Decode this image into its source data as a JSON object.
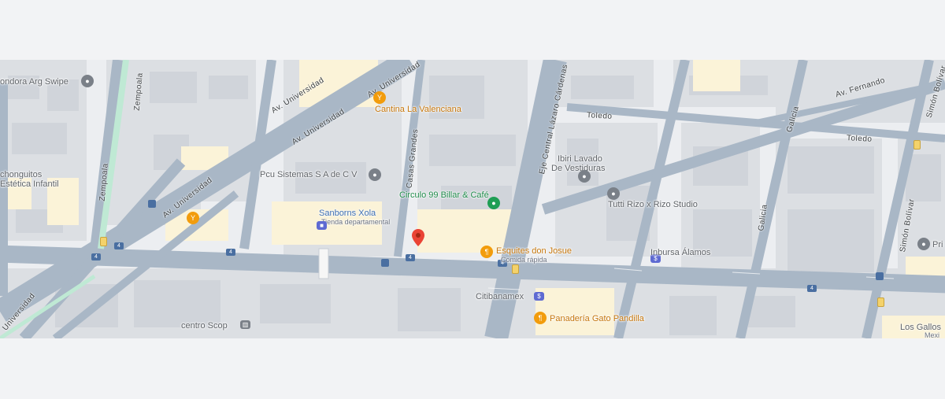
{
  "map": {
    "colors": {
      "road": "#a9b7c6",
      "block": "#dcdfe3",
      "building": "#d4d7dc",
      "commercial": "#fbf3d8",
      "median": "#bfe9d4",
      "pin": "#ea4335"
    },
    "streets": {
      "av_universidad_1": "Av. Universidad",
      "av_universidad_2": "Av. Universidad",
      "av_universidad_3": "Av. Universidad",
      "av_universidad_4": "Av. Universidad",
      "av_universidad_5": "Universidad",
      "zempoala_1": "Zempoala",
      "zempoala_2": "Zempoala",
      "casas_grandes": "Casas Grandes",
      "eje_central": "Eje Central Lázaro Cárdenas",
      "toledo_1": "Toledo",
      "toledo_2": "Toledo",
      "av_fernando": "Av. Fernando",
      "galicia_1": "Galicia",
      "galicia_2": "Galicia",
      "simon_bolivar_1": "Simón Bolívar",
      "simon_bolivar_2": "Simón Bolívar"
    },
    "route_shields": [
      "4",
      "4",
      "4",
      "4",
      "4",
      "4"
    ],
    "places": {
      "condora": "ondora Arg Swipe",
      "chonguitos_1": "chonguitos",
      "chonguitos_2": "Estética Infantil",
      "cantina": "Cantina La Valenciana",
      "pcu": "Pcu Sistemas S A de C V",
      "circulo": "Circulo 99 Billar & Café",
      "sanborns": "Sanborns Xola",
      "sanborns_sub": "Tienda departamental",
      "esquites": "Esquites don Josue",
      "esquites_sub": "Comida rápida",
      "lavado_1": "Ibiri Lavado",
      "lavado_2": "De Vestiduras",
      "tutti": "Tutti Rizo x Rizo Studio",
      "inbursa": "Inbursa Álamos",
      "citibanamex": "Citibanamex",
      "panaderia": "Panadería Gato Pandilla",
      "centro": "centro Scop",
      "los_gallos": "Los Gallos",
      "mexi": "Mexi",
      "pri": "Pri"
    }
  }
}
